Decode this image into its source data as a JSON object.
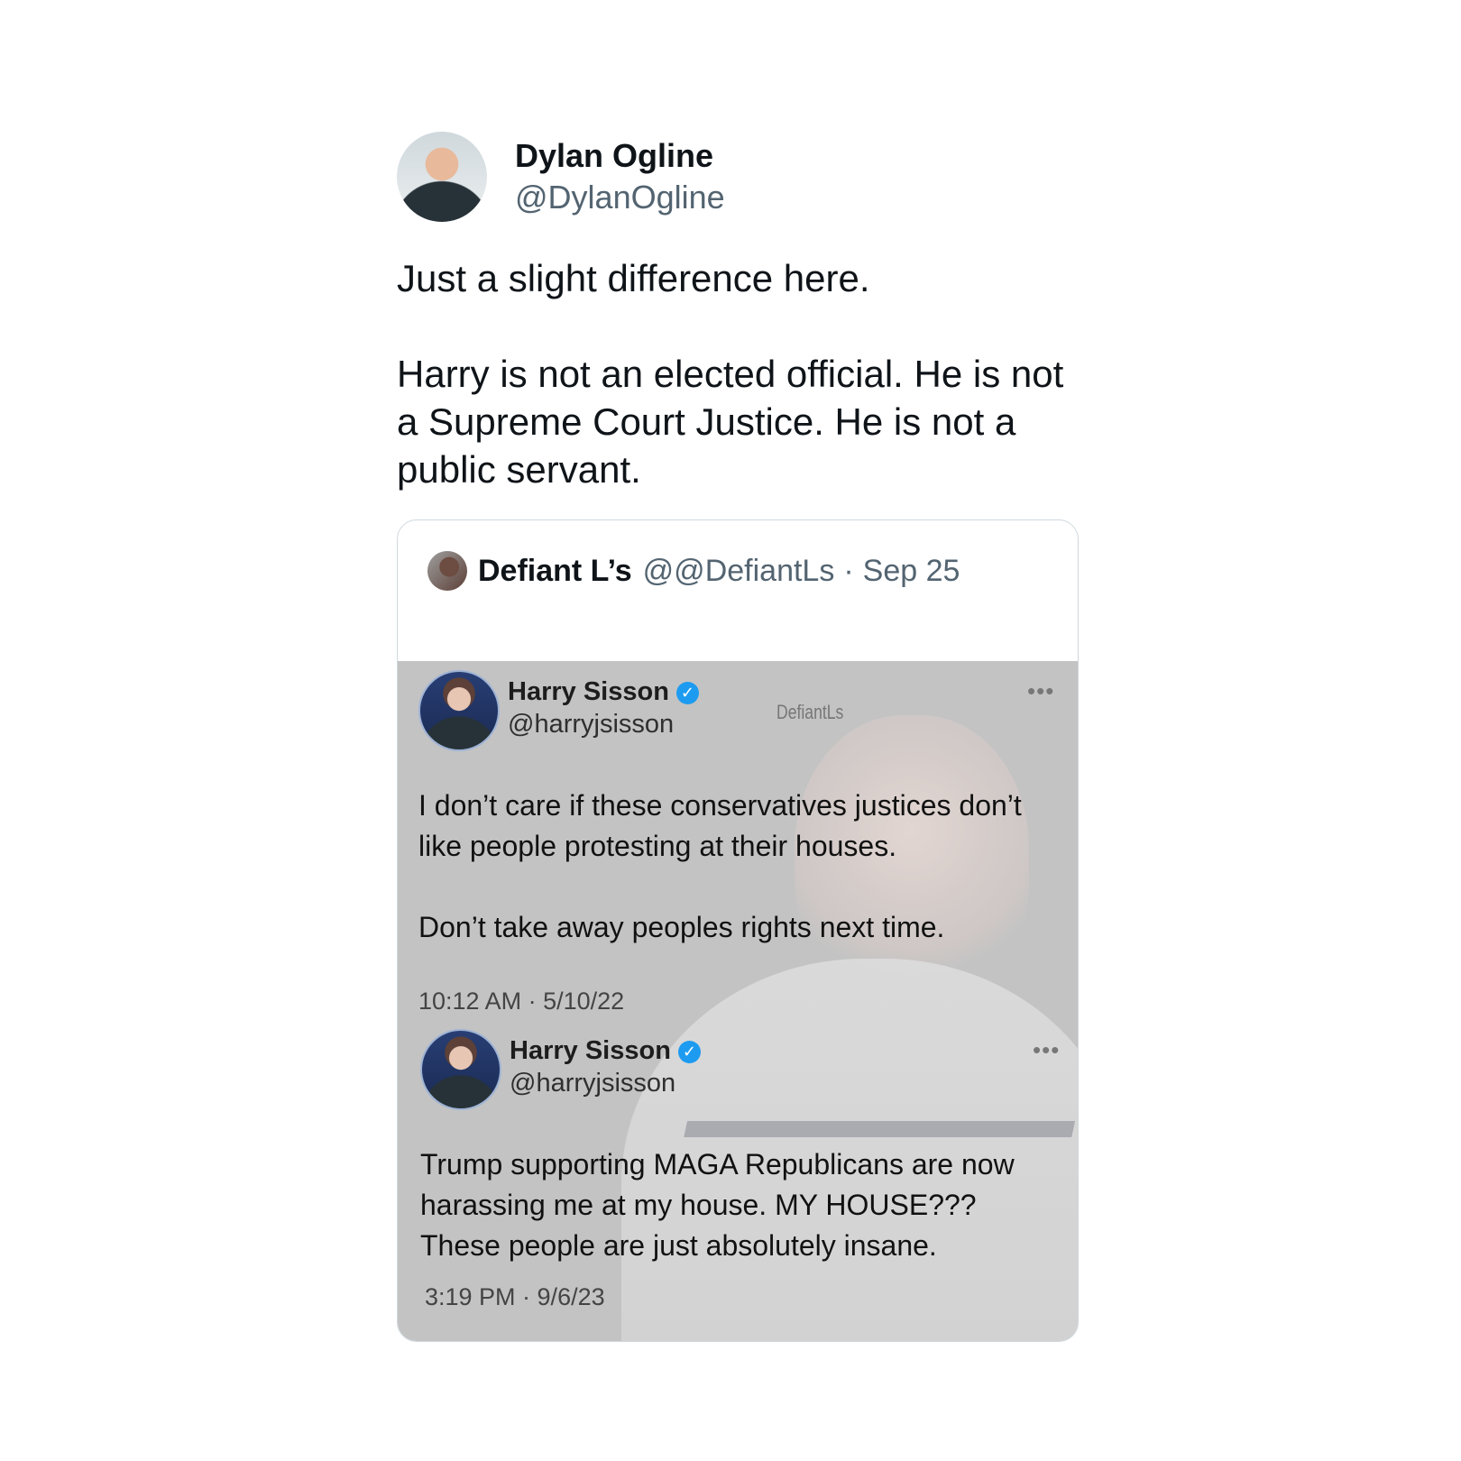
{
  "main_tweet": {
    "author_name": "Dylan Ogline",
    "author_handle": "@DylanOgline",
    "text": "Just a slight difference here.\n\nHarry is not an elected official. He is not a Supreme Court Justice. He is not a public servant."
  },
  "quoted_tweet": {
    "author_name": "Defiant L’s",
    "author_handle": "@@DefiantLs",
    "separator": "·",
    "date": "Sep 25",
    "watermark": "DefiantLs",
    "embedded_tweets": [
      {
        "name": "Harry Sisson",
        "handle": "@harryjsisson",
        "text": "I don’t care if these conservatives justices don’t like people protesting at their houses.\n\nDon’t take away peoples rights next time.",
        "time": "10:12 AM · 5/10/22"
      },
      {
        "name": "Harry Sisson",
        "handle": "@harryjsisson",
        "text": "Trump supporting MAGA Republicans are now harassing me at my house. MY HOUSE??? These people are just absolutely insane.",
        "time": "3:19 PM · 9/6/23"
      }
    ]
  },
  "icons": {
    "verified": "verified-check-icon",
    "more": "more-dots-icon"
  }
}
